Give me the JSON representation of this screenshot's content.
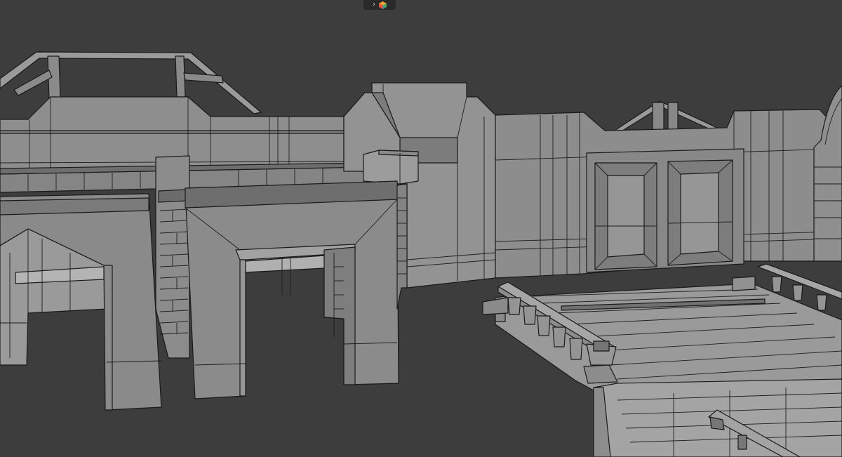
{
  "viewport": {
    "background_color": "#3d3d3d",
    "mesh_color": "#8c8c8c",
    "edge_color": "#1a1a1a"
  },
  "header": {
    "overlay_toggle": {
      "chevron_icon": "chevron-right-icon",
      "gizmo_icon": "colored-cube-icon",
      "gizmo_colors": [
        "#e84c3d",
        "#f3a536",
        "#3fae5a",
        "#3a8de0"
      ]
    }
  }
}
